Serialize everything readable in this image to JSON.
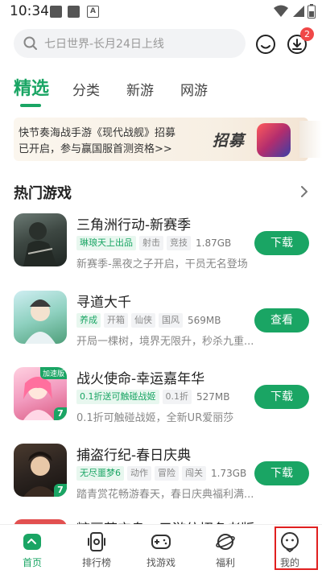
{
  "status_bar": {
    "time": "10:34",
    "notification_letter": "A"
  },
  "search": {
    "text": "七日世界-长月24日上线"
  },
  "header": {
    "download_badge": "2"
  },
  "tabs": [
    {
      "label": "精选",
      "active": true
    },
    {
      "label": "分类"
    },
    {
      "label": "新游"
    },
    {
      "label": "网游"
    }
  ],
  "banner": {
    "line1": "快节奏海战手游《现代战舰》招募",
    "line2": "已开启，参与赢国服首测资格>>",
    "tag": "招募"
  },
  "section": {
    "title": "热门游戏"
  },
  "games": [
    {
      "name": "三角洲行动-新赛季",
      "tags": [
        "琳琅天上出品",
        "射击",
        "竞技"
      ],
      "size": "1.87GB",
      "desc": "新赛季-黑夜之子开启，干员无名登场",
      "action": "下载"
    },
    {
      "name": "寻道大千",
      "tags": [
        "养成",
        "开箱",
        "仙侠",
        "国风"
      ],
      "size": "569MB",
      "desc": "开局一棵树，境界无限升，秒杀九重...",
      "action": "查看"
    },
    {
      "name": "战火使命-幸运嘉年华",
      "tags": [
        "0.1折送可触碰战姬",
        "0.1折"
      ],
      "size": "527MB",
      "desc": "0.1折可触碰战姬，全新UR爱丽莎",
      "action": "下载",
      "icon_badge": "加速版",
      "icon_corner": "7"
    },
    {
      "name": "捕盗行纪-春日庆典",
      "tags": [
        "无尽噩梦6",
        "动作",
        "冒险",
        "闯关"
      ],
      "size": "1.73GB",
      "desc": "踏青赏花畅游春天，春日庆典福利满...",
      "action": "下载",
      "icon_corner": "7"
    }
  ],
  "partial_game": {
    "name": "糖豆荒宝岛 - 元游仿招条老版"
  },
  "bottom_nav": [
    {
      "label": "首页",
      "icon": "home-icon",
      "active": true
    },
    {
      "label": "排行榜",
      "icon": "ranking-icon"
    },
    {
      "label": "找游戏",
      "icon": "gamepad-icon"
    },
    {
      "label": "福利",
      "icon": "planet-icon"
    },
    {
      "label": "我的",
      "icon": "profile-icon"
    }
  ],
  "colors": {
    "accent": "#1aa564",
    "badge": "#f04848",
    "highlight": "#e02020"
  }
}
